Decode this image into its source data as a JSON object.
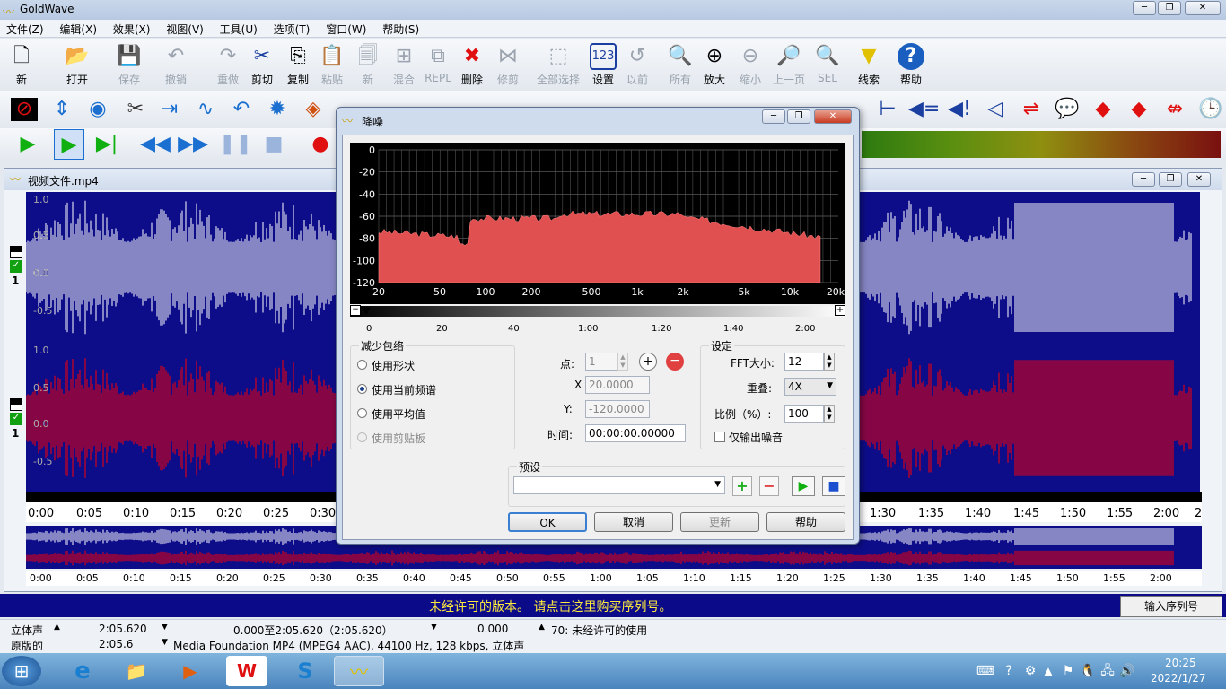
{
  "app": {
    "title": "GoldWave"
  },
  "menu": [
    "文件(Z)",
    "编辑(X)",
    "效果(X)",
    "视图(V)",
    "工具(U)",
    "选项(T)",
    "窗口(W)",
    "帮助(S)"
  ],
  "toolbar1": {
    "new": "新",
    "open": "打开",
    "save": "保存",
    "undo": "撤销",
    "redo": "重做",
    "cut": "剪切",
    "copy": "复制",
    "paste": "粘贴",
    "paste_new": "新",
    "mix": "混合",
    "repl": "REPL",
    "delete": "删除",
    "trim": "修剪",
    "select_all": "全部选择",
    "settings": "设置",
    "previous": "以前",
    "all": "所有",
    "zoom_in": "放大",
    "zoom_out": "缩小",
    "zoom_prev": "上一页",
    "sel": "SEL",
    "cue": "线索",
    "help": "帮助"
  },
  "document": {
    "title": "视频文件.mp4",
    "channel_labels": [
      "1.0",
      "0.5",
      "0.0",
      "-0.5",
      "1.0",
      "0.5",
      "0.0",
      "-0.5"
    ],
    "channel_numbers": [
      "1",
      "1"
    ],
    "timeline_labels": [
      "0:00",
      "0:05",
      "0:10",
      "0:15",
      "0:20",
      "0:25",
      "0:30",
      "1:30",
      "1:35",
      "1:40",
      "1:45",
      "1:50",
      "1:55",
      "2:00",
      "2"
    ],
    "overview_labels": [
      "0:00",
      "0:05",
      "0:10",
      "0:15",
      "0:20",
      "0:25",
      "0:30",
      "0:35",
      "0:40",
      "0:45",
      "0:50",
      "0:55",
      "1:00",
      "1:05",
      "1:10",
      "1:15",
      "1:20",
      "1:25",
      "1:30",
      "1:35",
      "1:40",
      "1:45",
      "1:50",
      "1:55",
      "2:00"
    ]
  },
  "dialog": {
    "title": "降噪",
    "spectrum_y": [
      "0",
      "-20",
      "-40",
      "-60",
      "-80",
      "-100",
      "-120"
    ],
    "spectrum_x": [
      "20",
      "50",
      "100",
      "200",
      "500",
      "1k",
      "2k",
      "5k",
      "10k",
      "20k"
    ],
    "scale_labels": [
      "0",
      "20",
      "40",
      "1:00",
      "1:20",
      "1:40",
      "2:00"
    ],
    "reduce_group": "减少包络",
    "options": [
      "使用形状",
      "使用当前频谱",
      "使用平均值",
      "使用剪贴板"
    ],
    "selected_option": "使用当前频谱",
    "point_label": "点:",
    "point_value": "1",
    "x_label": "X",
    "x_value": "20.0000",
    "y_label": "Y:",
    "y_value": "-120.0000",
    "time_label": "时间:",
    "time_value": "00:00:00.00000",
    "settings_group": "设定",
    "fft_label": "FFT大小:",
    "fft_value": "12",
    "overlap_label": "重叠:",
    "overlap_value": "4X",
    "ratio_label": "比例（%）:",
    "ratio_value": "100",
    "noise_only_label": "仅输出噪音",
    "preset_group": "预设",
    "ok": "OK",
    "cancel": "取消",
    "update": "更新",
    "help": "帮助"
  },
  "banner": {
    "text": "未经许可的版本。 请点击这里购买序列号。",
    "button": "输入序列号"
  },
  "status": {
    "row1": [
      "立体声",
      "2:05.620",
      "0.000至2:05.620（2:05.620）",
      "0.000",
      "70: 未经许可的使用"
    ],
    "row2": [
      "原版的",
      "2:05.6",
      "Media Foundation MP4 (MPEG4 AAC), 44100 Hz, 128 kbps, 立体声"
    ]
  },
  "taskbar": {
    "time": "20:25",
    "date": "2022/1/27"
  },
  "colors": {
    "wave_bg": "#0d0d8a",
    "wave_left": "#ffffff",
    "wave_right": "#ff0000",
    "spectrum_fill": "#e05050"
  }
}
